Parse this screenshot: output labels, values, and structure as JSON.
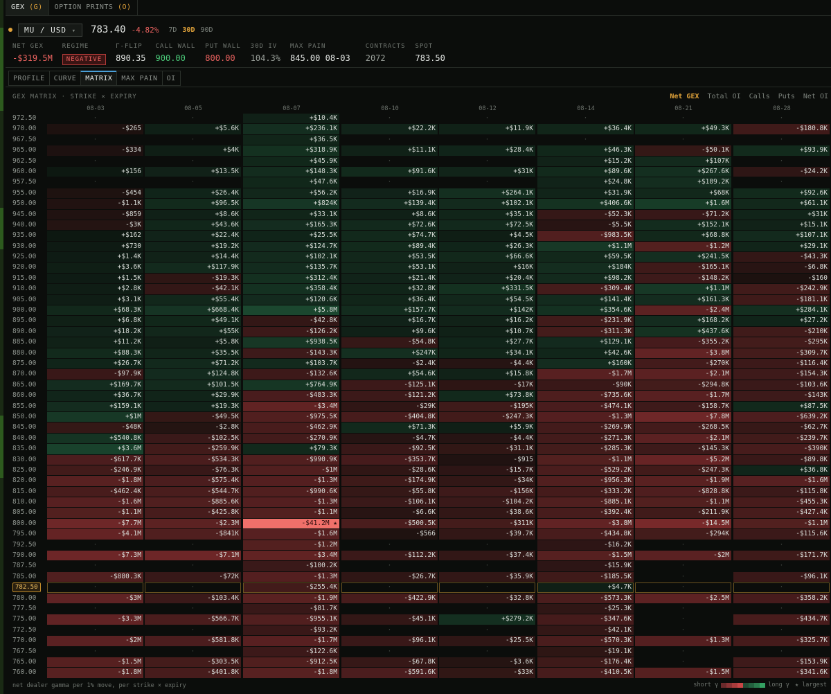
{
  "tabs": [
    {
      "label": "GEX",
      "count": "(G)",
      "active": true
    },
    {
      "label": "OPTION PRINTS",
      "count": "(O)",
      "active": false
    }
  ],
  "ticker": {
    "symbol": "MU / USD",
    "caret": "▾",
    "price": "783.40",
    "change": "-4.82%",
    "dte": [
      {
        "label": "7D",
        "active": false
      },
      {
        "label": "30D",
        "active": true
      },
      {
        "label": "90D",
        "active": false
      }
    ]
  },
  "stats": [
    {
      "label": "NET GEX",
      "value": "-$319.5M",
      "tone": "red"
    },
    {
      "label": "REGIME",
      "value": "NEGATIVE",
      "tone": "badge"
    },
    {
      "label": "Γ-FLIP",
      "value": "890.35",
      "tone": "white"
    },
    {
      "label": "CALL WALL",
      "value": "900.00",
      "tone": "green"
    },
    {
      "label": "PUT WALL",
      "value": "800.00",
      "tone": "red"
    },
    {
      "label": "30D IV",
      "value": "104.3%",
      "tone": "muted"
    },
    {
      "label": "MAX PAIN",
      "value": "845.00 08-03",
      "tone": "white"
    },
    {
      "label": "CONTRACTS",
      "value": "2072",
      "tone": "muted"
    },
    {
      "label": "SPOT",
      "value": "783.50",
      "tone": "white"
    }
  ],
  "subtabs": [
    {
      "label": "PROFILE",
      "active": false
    },
    {
      "label": "CURVE",
      "active": false
    },
    {
      "label": "MATRIX",
      "active": true
    },
    {
      "label": "MAX PAIN",
      "active": false
    },
    {
      "label": "OI",
      "active": false
    }
  ],
  "matrix_title": "GEX MATRIX · STRIKE × EXPIRY",
  "modes": [
    {
      "label": "Net GEX",
      "active": true
    },
    {
      "label": "Total OI",
      "active": false
    },
    {
      "label": "Calls",
      "active": false
    },
    {
      "label": "Puts",
      "active": false
    },
    {
      "label": "Net OI",
      "active": false
    }
  ],
  "expiries": [
    "08-03",
    "08-05",
    "08-07",
    "08-10",
    "08-12",
    "08-14",
    "08-21",
    "08-28"
  ],
  "empty_marker": "·",
  "rows": [
    {
      "strike": "972.50",
      "cells": [
        "",
        "",
        "+$10.4K",
        "",
        "",
        "",
        "",
        ""
      ]
    },
    {
      "strike": "970.00",
      "cells": [
        "-$265",
        "+$5.6K",
        "+$236.1K",
        "+$22.2K",
        "+$11.9K",
        "+$36.4K",
        "+$49.3K",
        "-$180.8K"
      ]
    },
    {
      "strike": "967.50",
      "cells": [
        "",
        "",
        "+$36.5K",
        "",
        "",
        "",
        "",
        ""
      ]
    },
    {
      "strike": "965.00",
      "cells": [
        "-$334",
        "+$4K",
        "+$318.9K",
        "+$11.1K",
        "+$28.4K",
        "+$46.3K",
        "-$50.1K",
        "+$93.9K"
      ]
    },
    {
      "strike": "962.50",
      "cells": [
        "",
        "",
        "+$45.9K",
        "",
        "",
        "+$15.2K",
        "+$107K",
        ""
      ]
    },
    {
      "strike": "960.00",
      "cells": [
        "+$156",
        "+$13.5K",
        "+$148.3K",
        "+$91.6K",
        "+$31K",
        "+$89.6K",
        "+$267.6K",
        "-$24.2K"
      ]
    },
    {
      "strike": "957.50",
      "cells": [
        "",
        "",
        "+$47.6K",
        "",
        "",
        "+$24.8K",
        "+$189.2K",
        ""
      ]
    },
    {
      "strike": "955.00",
      "cells": [
        "-$454",
        "+$26.4K",
        "+$56.2K",
        "+$16.9K",
        "+$264.1K",
        "+$31.9K",
        "+$68K",
        "+$92.6K"
      ]
    },
    {
      "strike": "950.00",
      "cells": [
        "-$1.1K",
        "+$96.5K",
        "+$824K",
        "+$139.4K",
        "+$102.1K",
        "+$406.6K",
        "+$1.6M",
        "+$61.1K"
      ]
    },
    {
      "strike": "945.00",
      "cells": [
        "-$859",
        "+$8.6K",
        "+$33.1K",
        "+$8.6K",
        "+$35.1K",
        "-$52.3K",
        "-$71.2K",
        "+$31K"
      ]
    },
    {
      "strike": "940.00",
      "cells": [
        "-$3K",
        "+$43.6K",
        "+$165.3K",
        "+$72.6K",
        "+$72.5K",
        "-$5.5K",
        "+$152.1K",
        "+$15.1K"
      ]
    },
    {
      "strike": "935.00",
      "cells": [
        "+$162",
        "+$22.4K",
        "+$25.5K",
        "+$74.7K",
        "+$4.5K",
        "-$983.5K",
        "+$68.8K",
        "+$107.1K"
      ]
    },
    {
      "strike": "930.00",
      "cells": [
        "+$730",
        "+$19.2K",
        "+$124.7K",
        "+$89.4K",
        "+$26.3K",
        "+$1.1M",
        "-$1.2M",
        "+$29.1K"
      ]
    },
    {
      "strike": "925.00",
      "cells": [
        "+$1.4K",
        "+$14.4K",
        "+$102.1K",
        "+$53.5K",
        "+$66.6K",
        "+$59.5K",
        "+$241.5K",
        "-$43.3K"
      ]
    },
    {
      "strike": "920.00",
      "cells": [
        "+$3.6K",
        "+$117.9K",
        "+$135.7K",
        "+$53.1K",
        "+$16K",
        "+$184K",
        "-$165.1K",
        "-$6.8K"
      ]
    },
    {
      "strike": "915.00",
      "cells": [
        "+$1.5K",
        "-$19.3K",
        "+$312.4K",
        "+$21.4K",
        "+$20.4K",
        "+$98.2K",
        "-$148.2K",
        "-$160"
      ]
    },
    {
      "strike": "910.00",
      "cells": [
        "+$2.8K",
        "-$42.1K",
        "+$358.4K",
        "+$32.8K",
        "+$331.5K",
        "-$309.4K",
        "+$1.1M",
        "-$242.9K"
      ]
    },
    {
      "strike": "905.00",
      "cells": [
        "+$3.1K",
        "+$55.4K",
        "+$120.6K",
        "+$36.4K",
        "+$54.5K",
        "+$141.4K",
        "+$161.3K",
        "-$181.1K"
      ]
    },
    {
      "strike": "900.00",
      "cells": [
        "+$68.3K",
        "+$668.4K",
        "+$5.8M",
        "+$157.7K",
        "+$142K",
        "+$354.6K",
        "-$2.4M",
        "+$284.1K"
      ]
    },
    {
      "strike": "895.00",
      "cells": [
        "+$6.8K",
        "+$49.1K",
        "-$42.8K",
        "+$16.7K",
        "+$16.2K",
        "-$231.9K",
        "+$168.2K",
        "+$27.2K"
      ]
    },
    {
      "strike": "890.00",
      "cells": [
        "+$18.2K",
        "+$55K",
        "-$126.2K",
        "+$9.6K",
        "+$10.7K",
        "-$311.3K",
        "+$437.6K",
        "-$210K"
      ]
    },
    {
      "strike": "885.00",
      "cells": [
        "+$11.2K",
        "+$5.8K",
        "+$938.5K",
        "-$54.8K",
        "+$27.7K",
        "+$129.1K",
        "-$355.2K",
        "-$295K"
      ]
    },
    {
      "strike": "880.00",
      "cells": [
        "+$88.3K",
        "+$35.5K",
        "-$143.3K",
        "+$247K",
        "+$34.1K",
        "+$42.6K",
        "-$3.8M",
        "-$309.7K"
      ]
    },
    {
      "strike": "875.00",
      "cells": [
        "+$26.7K",
        "+$71.2K",
        "+$103.7K",
        "-$2.4K",
        "-$4.4K",
        "+$160K",
        "-$270K",
        "-$116.4K"
      ]
    },
    {
      "strike": "870.00",
      "cells": [
        "-$97.9K",
        "+$124.8K",
        "-$132.6K",
        "+$54.6K",
        "+$15.8K",
        "-$1.7M",
        "-$2.1M",
        "-$154.3K"
      ]
    },
    {
      "strike": "865.00",
      "cells": [
        "+$169.7K",
        "+$101.5K",
        "+$764.9K",
        "-$125.1K",
        "-$17K",
        "-$90K",
        "-$294.8K",
        "-$103.6K"
      ]
    },
    {
      "strike": "860.00",
      "cells": [
        "+$36.7K",
        "+$29.9K",
        "-$483.3K",
        "-$121.2K",
        "+$73.8K",
        "-$735.6K",
        "-$1.7M",
        "-$143K"
      ]
    },
    {
      "strike": "855.00",
      "cells": [
        "+$159.1K",
        "+$19.3K",
        "-$3.4M",
        "-$29K",
        "-$195K",
        "-$474.1K",
        "-$158.7K",
        "+$87.5K"
      ]
    },
    {
      "strike": "850.00",
      "cells": [
        "+$1M",
        "-$49.5K",
        "-$975.5K",
        "-$404.8K",
        "-$247.3K",
        "-$1.3M",
        "-$7.8M",
        "-$639.2K"
      ]
    },
    {
      "strike": "845.00",
      "cells": [
        "-$48K",
        "-$2.8K",
        "-$462.9K",
        "+$71.3K",
        "+$5.9K",
        "-$269.9K",
        "-$268.5K",
        "-$62.7K"
      ]
    },
    {
      "strike": "840.00",
      "cells": [
        "+$540.8K",
        "-$102.5K",
        "-$270.9K",
        "-$4.7K",
        "-$4.4K",
        "-$271.3K",
        "-$2.1M",
        "-$239.7K"
      ]
    },
    {
      "strike": "835.00",
      "cells": [
        "+$3.6M",
        "-$259.9K",
        "+$79.3K",
        "-$92.5K",
        "-$31.1K",
        "-$285.3K",
        "-$145.3K",
        "-$390K"
      ]
    },
    {
      "strike": "830.00",
      "cells": [
        "-$617.7K",
        "-$534.3K",
        "-$990.9K",
        "-$353.7K",
        "-$915",
        "-$1.1M",
        "-$5.2M",
        "-$89.8K"
      ]
    },
    {
      "strike": "825.00",
      "cells": [
        "-$246.9K",
        "-$76.3K",
        "-$1M",
        "-$28.6K",
        "-$15.7K",
        "-$529.2K",
        "-$247.3K",
        "+$36.8K"
      ]
    },
    {
      "strike": "820.00",
      "cells": [
        "-$1.8M",
        "-$575.4K",
        "-$1.3M",
        "-$174.9K",
        "-$34K",
        "-$956.3K",
        "-$1.9M",
        "-$1.6M"
      ]
    },
    {
      "strike": "815.00",
      "cells": [
        "-$462.4K",
        "-$544.7K",
        "-$990.6K",
        "-$55.8K",
        "-$156K",
        "-$333.2K",
        "-$828.8K",
        "-$115.8K"
      ]
    },
    {
      "strike": "810.00",
      "cells": [
        "-$1.6M",
        "-$885.6K",
        "-$1.3M",
        "-$106.1K",
        "-$104.2K",
        "-$885.1K",
        "-$1.1M",
        "-$455.3K"
      ]
    },
    {
      "strike": "805.00",
      "cells": [
        "-$1.1M",
        "-$425.8K",
        "-$1.1M",
        "-$6.6K",
        "-$38.6K",
        "-$392.4K",
        "-$211.9K",
        "-$427.4K"
      ]
    },
    {
      "strike": "800.00",
      "cells": [
        "-$7.7M",
        "-$2.3M",
        "-$41.2M ★",
        "-$500.5K",
        "-$311K",
        "-$3.8M",
        "-$14.5M",
        "-$1.1M"
      ]
    },
    {
      "strike": "795.00",
      "cells": [
        "-$4.1M",
        "-$841K",
        "-$1.6M",
        "-$566",
        "-$39.7K",
        "-$434.8K",
        "-$294K",
        "-$115.6K"
      ]
    },
    {
      "strike": "792.50",
      "cells": [
        "",
        "",
        "-$1.2M",
        "",
        "",
        "-$16.2K",
        "",
        ""
      ]
    },
    {
      "strike": "790.00",
      "cells": [
        "-$7.3M",
        "-$7.1M",
        "-$3.4M",
        "-$112.2K",
        "-$37.4K",
        "-$1.5M",
        "-$2M",
        "-$171.7K"
      ]
    },
    {
      "strike": "787.50",
      "cells": [
        "",
        "",
        "-$100.2K",
        "",
        "",
        "-$15.9K",
        "",
        ""
      ]
    },
    {
      "strike": "785.00",
      "cells": [
        "-$880.3K",
        "-$72K",
        "-$1.3M",
        "-$26.7K",
        "-$35.9K",
        "-$185.5K",
        "",
        "-$96.1K"
      ]
    },
    {
      "strike": "782.50",
      "spot": true,
      "cells": [
        "",
        "",
        "-$255.4K",
        "",
        "",
        "+$4.7K",
        "",
        ""
      ]
    },
    {
      "strike": "780.00",
      "cells": [
        "-$3M",
        "-$103.4K",
        "-$1.9M",
        "-$422.9K",
        "-$32.8K",
        "-$573.3K",
        "-$2.5M",
        "-$358.2K"
      ]
    },
    {
      "strike": "777.50",
      "cells": [
        "",
        "",
        "-$81.7K",
        "",
        "",
        "-$25.3K",
        "",
        ""
      ]
    },
    {
      "strike": "775.00",
      "cells": [
        "-$3.3M",
        "-$566.7K",
        "-$955.1K",
        "-$45.1K",
        "+$279.2K",
        "-$347.6K",
        "",
        "-$434.7K"
      ]
    },
    {
      "strike": "772.50",
      "cells": [
        "",
        "",
        "-$93.2K",
        "",
        "",
        "-$42.1K",
        "",
        ""
      ]
    },
    {
      "strike": "770.00",
      "cells": [
        "-$2M",
        "-$581.8K",
        "-$1.7M",
        "-$96.1K",
        "-$25.5K",
        "-$570.3K",
        "-$1.3M",
        "-$325.7K"
      ]
    },
    {
      "strike": "767.50",
      "cells": [
        "",
        "",
        "-$122.6K",
        "",
        "",
        "-$19.1K",
        "",
        ""
      ]
    },
    {
      "strike": "765.00",
      "cells": [
        "-$1.5M",
        "-$303.5K",
        "-$912.5K",
        "-$67.8K",
        "-$3.6K",
        "-$176.4K",
        "",
        "-$153.9K"
      ]
    },
    {
      "strike": "760.00",
      "cells": [
        "-$1.8M",
        "-$401.8K",
        "-$1.8M",
        "-$591.6K",
        "-$33K",
        "-$410.5K",
        "-$1.5M",
        "-$341.6K"
      ]
    }
  ],
  "footer": "net dealer gamma per 1% move, per strike × expiry",
  "legend": {
    "short": "short γ",
    "long": "long γ",
    "largest": "★ largest",
    "colors": [
      "#6b2a2b",
      "#8a3334",
      "#a93c3c",
      "#c84646",
      "#1f4a33",
      "#24603f",
      "#2a7a4c",
      "#34a162"
    ]
  }
}
